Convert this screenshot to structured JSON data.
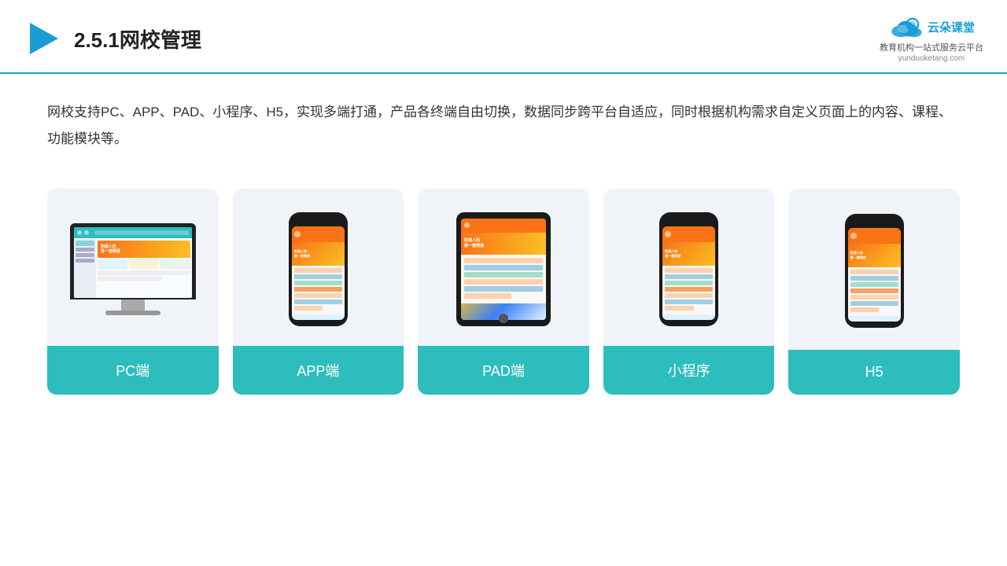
{
  "header": {
    "title": "2.5.1网校管理",
    "logo": {
      "name": "云朵课堂",
      "url": "yunduoketang.com",
      "tagline": "教育机构一站\n式服务云平台"
    }
  },
  "description": "网校支持PC、APP、PAD、小程序、H5，实现多端打通，产品各终端自由切换，数据同步跨平台自适应，同时根据机构需求自定义页面上的内容、课程、功能模块等。",
  "cards": [
    {
      "id": "pc",
      "label": "PC端"
    },
    {
      "id": "app",
      "label": "APP端"
    },
    {
      "id": "pad",
      "label": "PAD端"
    },
    {
      "id": "miniapp",
      "label": "小程序"
    },
    {
      "id": "h5",
      "label": "H5"
    }
  ],
  "colors": {
    "teal": "#2dbdbc",
    "blue_accent": "#1a9cd6",
    "header_border": "#1a9cd6"
  }
}
